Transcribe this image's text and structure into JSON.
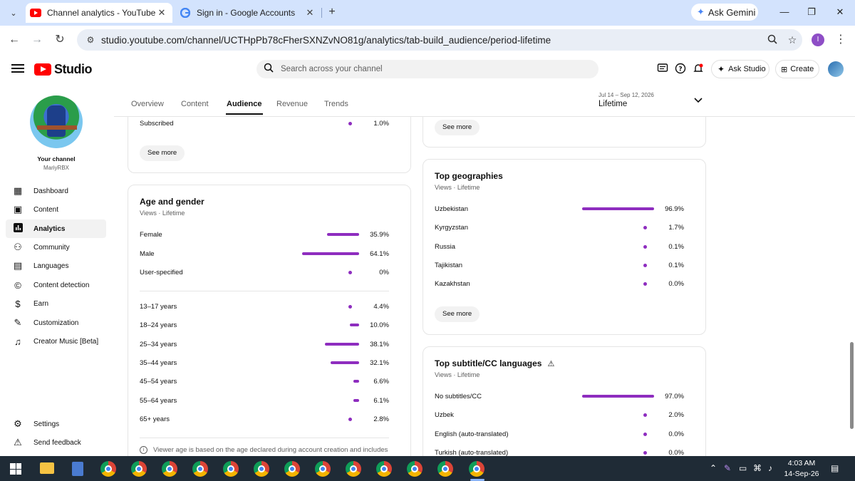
{
  "browser": {
    "tabs": [
      {
        "title": "Channel analytics - YouTube Stu",
        "active": true
      },
      {
        "title": "Sign in - Google Accounts",
        "active": false
      }
    ],
    "ask_gemini": "Ask Gemini",
    "url": "studio.youtube.com/channel/UCTHpPb78cFherSXNZvNO81g/analytics/tab-build_audience/period-lifetime",
    "profile_initial": "I"
  },
  "header": {
    "logo_text": "Studio",
    "search_placeholder": "Search across your channel",
    "ask_studio": "Ask Studio",
    "create": "Create"
  },
  "sidebar": {
    "your_channel": "Your channel",
    "channel_name": "MariyRBX",
    "items": [
      {
        "label": "Dashboard",
        "icon": "dashboard-icon"
      },
      {
        "label": "Content",
        "icon": "content-icon"
      },
      {
        "label": "Analytics",
        "icon": "analytics-icon",
        "active": true
      },
      {
        "label": "Community",
        "icon": "community-icon"
      },
      {
        "label": "Languages",
        "icon": "languages-icon"
      },
      {
        "label": "Content detection",
        "icon": "copyright-icon"
      },
      {
        "label": "Earn",
        "icon": "earn-icon"
      },
      {
        "label": "Customization",
        "icon": "customization-icon"
      },
      {
        "label": "Creator Music [Beta]",
        "icon": "music-icon"
      }
    ],
    "settings": "Settings",
    "send_feedback": "Send feedback"
  },
  "tabs": {
    "items": [
      "Overview",
      "Content",
      "Audience",
      "Revenue",
      "Trends"
    ],
    "active": "Audience",
    "period_range": "Jul 14 – Sep 12, 2026",
    "period_value": "Lifetime"
  },
  "subscription_card": {
    "row_label": "Subscribed",
    "row_value": "1.0%",
    "see_more": "See more"
  },
  "top_right_card": {
    "see_more": "See more"
  },
  "age_gender": {
    "title": "Age and gender",
    "subtitle": "Views · Lifetime",
    "gender": [
      {
        "label": "Female",
        "value": "35.9%",
        "pct": 35.9
      },
      {
        "label": "Male",
        "value": "64.1%",
        "pct": 64.1
      },
      {
        "label": "User-specified",
        "value": "0%",
        "pct": 0
      }
    ],
    "ages": [
      {
        "label": "13–17 years",
        "value": "4.4%",
        "pct": 4.4
      },
      {
        "label": "18–24 years",
        "value": "10.0%",
        "pct": 10.0
      },
      {
        "label": "25–34 years",
        "value": "38.1%",
        "pct": 38.1
      },
      {
        "label": "35–44 years",
        "value": "32.1%",
        "pct": 32.1
      },
      {
        "label": "45–54 years",
        "value": "6.6%",
        "pct": 6.6
      },
      {
        "label": "55–64 years",
        "value": "6.1%",
        "pct": 6.1
      },
      {
        "label": "65+ years",
        "value": "2.8%",
        "pct": 2.8
      }
    ],
    "note": "Viewer age is based on the age declared during account creation and includes"
  },
  "geographies": {
    "title": "Top geographies",
    "subtitle": "Views · Lifetime",
    "rows": [
      {
        "label": "Uzbekistan",
        "value": "96.9%",
        "pct": 96.9
      },
      {
        "label": "Kyrgyzstan",
        "value": "1.7%",
        "pct": 1.7
      },
      {
        "label": "Russia",
        "value": "0.1%",
        "pct": 0.1
      },
      {
        "label": "Tajikistan",
        "value": "0.1%",
        "pct": 0.1
      },
      {
        "label": "Kazakhstan",
        "value": "0.0%",
        "pct": 0.0
      }
    ],
    "see_more": "See more"
  },
  "subtitles": {
    "title": "Top subtitle/CC languages",
    "subtitle": "Views · Lifetime",
    "rows": [
      {
        "label": "No subtitles/CC",
        "value": "97.0%",
        "pct": 97.0
      },
      {
        "label": "Uzbek",
        "value": "2.0%",
        "pct": 2.0
      },
      {
        "label": "English (auto-translated)",
        "value": "0.0%",
        "pct": 0.0
      },
      {
        "label": "Turkish (auto-translated)",
        "value": "0.0%",
        "pct": 0.0
      }
    ]
  },
  "taskbar": {
    "time": "4:03 AM",
    "date": "14-Sep-26"
  },
  "colors": {
    "bar": "#8e2dbf",
    "chrome_tabbar": "#d3e3fd",
    "youtube_red": "#ff0000"
  }
}
